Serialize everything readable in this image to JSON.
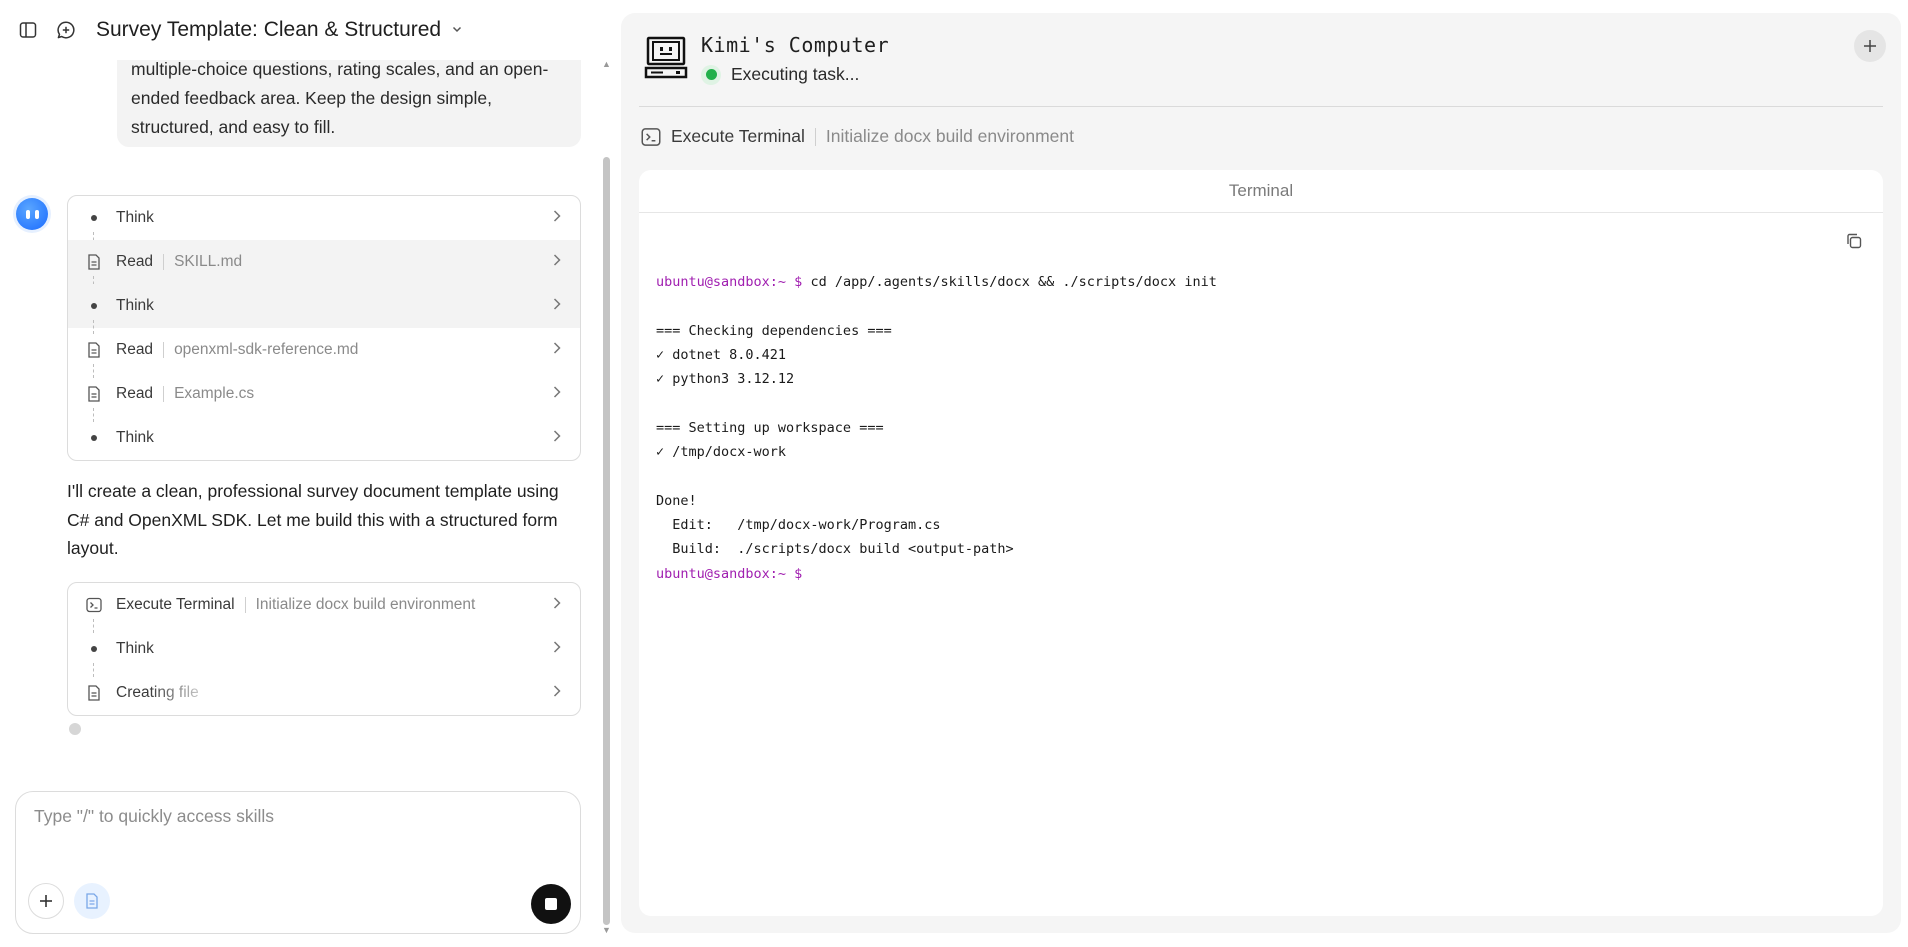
{
  "header": {
    "title": "Survey Template: Clean & Structured"
  },
  "chat": {
    "user_message": "multiple-choice questions, rating scales, and an open-ended feedback area. Keep the design simple, structured, and easy to fill.",
    "user_message_lines": [
      "multiple-choice questions, rating scales, and an open-",
      "ended feedback area. Keep the design simple,",
      "structured, and easy to fill."
    ],
    "steps_group1": [
      {
        "label": "Think",
        "sub": "",
        "icon": "dot"
      },
      {
        "label": "Read",
        "sub": "SKILL.md",
        "icon": "file"
      },
      {
        "label": "Think",
        "sub": "",
        "icon": "dot"
      },
      {
        "label": "Read",
        "sub": "openxml-sdk-reference.md",
        "icon": "file"
      },
      {
        "label": "Read",
        "sub": "Example.cs",
        "icon": "file"
      },
      {
        "label": "Think",
        "sub": "",
        "icon": "dot"
      }
    ],
    "assistant_lines": [
      "I'll create a clean, professional survey document template using",
      "C# and OpenXML SDK. Let me build this with a structured form",
      "layout."
    ],
    "steps_group2": [
      {
        "label": "Execute Terminal",
        "sub": "Initialize docx build environment",
        "icon": "terminal"
      },
      {
        "label": "Think",
        "sub": "",
        "icon": "dot"
      },
      {
        "label": "Creating file",
        "sub": "",
        "icon": "file"
      }
    ]
  },
  "input": {
    "placeholder": "Type \"/\" to quickly access skills"
  },
  "computer": {
    "title": "Kimi's Computer",
    "status": "Executing task...",
    "task_label": "Execute Terminal",
    "task_sub": "Initialize docx build environment",
    "terminal_title": "Terminal",
    "prompt": "ubuntu@sandbox:~ $",
    "command": " cd /app/.agents/skills/docx && ./scripts/docx init",
    "output_lines": [
      "",
      "=== Checking dependencies ===",
      "✓ dotnet 8.0.421",
      "✓ python3 3.12.12",
      "",
      "=== Setting up workspace ===",
      "✓ /tmp/docx-work",
      "",
      "Done!",
      "  Edit:   /tmp/docx-work/Program.cs",
      "  Build:  ./scripts/docx build <output-path>"
    ],
    "final_prompt": "ubuntu@sandbox:~ $"
  },
  "colors": {
    "accent_blue": "#1a6bff",
    "status_green": "#22b04b",
    "prompt_purple": "#a01fb0"
  }
}
